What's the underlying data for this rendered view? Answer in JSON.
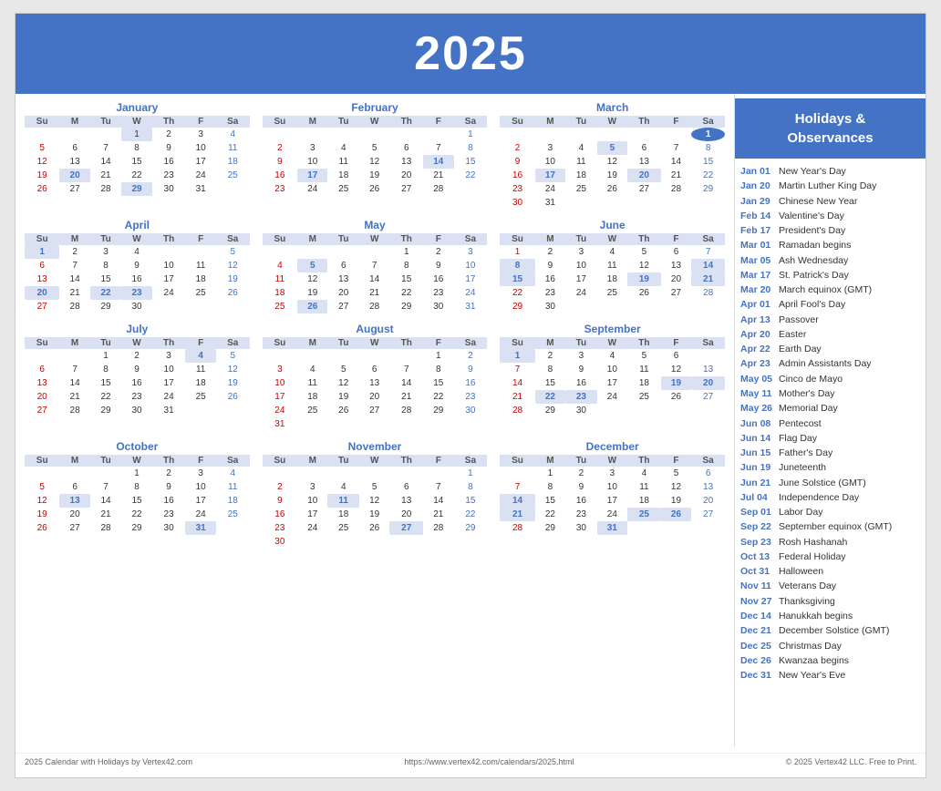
{
  "header": {
    "year": "2025"
  },
  "sidebar": {
    "title": "Holidays &\nObservances",
    "holidays": [
      {
        "date": "Jan 01",
        "name": "New Year's Day"
      },
      {
        "date": "Jan 20",
        "name": "Martin Luther King Day"
      },
      {
        "date": "Jan 29",
        "name": "Chinese New Year"
      },
      {
        "date": "Feb 14",
        "name": "Valentine's Day"
      },
      {
        "date": "Feb 17",
        "name": "President's Day"
      },
      {
        "date": "Mar 01",
        "name": "Ramadan begins"
      },
      {
        "date": "Mar 05",
        "name": "Ash Wednesday"
      },
      {
        "date": "Mar 17",
        "name": "St. Patrick's Day"
      },
      {
        "date": "Mar 20",
        "name": "March equinox (GMT)"
      },
      {
        "date": "Apr 01",
        "name": "April Fool's Day"
      },
      {
        "date": "Apr 13",
        "name": "Passover"
      },
      {
        "date": "Apr 20",
        "name": "Easter"
      },
      {
        "date": "Apr 22",
        "name": "Earth Day"
      },
      {
        "date": "Apr 23",
        "name": "Admin Assistants Day"
      },
      {
        "date": "May 05",
        "name": "Cinco de Mayo"
      },
      {
        "date": "May 11",
        "name": "Mother's Day"
      },
      {
        "date": "May 26",
        "name": "Memorial Day"
      },
      {
        "date": "Jun 08",
        "name": "Pentecost"
      },
      {
        "date": "Jun 14",
        "name": "Flag Day"
      },
      {
        "date": "Jun 15",
        "name": "Father's Day"
      },
      {
        "date": "Jun 19",
        "name": "Juneteenth"
      },
      {
        "date": "Jun 21",
        "name": "June Solstice (GMT)"
      },
      {
        "date": "Jul 04",
        "name": "Independence Day"
      },
      {
        "date": "Sep 01",
        "name": "Labor Day"
      },
      {
        "date": "Sep 22",
        "name": "September equinox (GMT)"
      },
      {
        "date": "Sep 23",
        "name": "Rosh Hashanah"
      },
      {
        "date": "Oct 13",
        "name": "Federal Holiday"
      },
      {
        "date": "Oct 31",
        "name": "Halloween"
      },
      {
        "date": "Nov 11",
        "name": "Veterans Day"
      },
      {
        "date": "Nov 27",
        "name": "Thanksgiving"
      },
      {
        "date": "Dec 14",
        "name": "Hanukkah begins"
      },
      {
        "date": "Dec 21",
        "name": "December Solstice (GMT)"
      },
      {
        "date": "Dec 25",
        "name": "Christmas Day"
      },
      {
        "date": "Dec 26",
        "name": "Kwanzaa begins"
      },
      {
        "date": "Dec 31",
        "name": "New Year's Eve"
      }
    ]
  },
  "footer": {
    "left": "2025 Calendar with Holidays by Vertex42.com",
    "center": "https://www.vertex42.com/calendars/2025.html",
    "right": "© 2025 Vertex42 LLC. Free to Print."
  }
}
